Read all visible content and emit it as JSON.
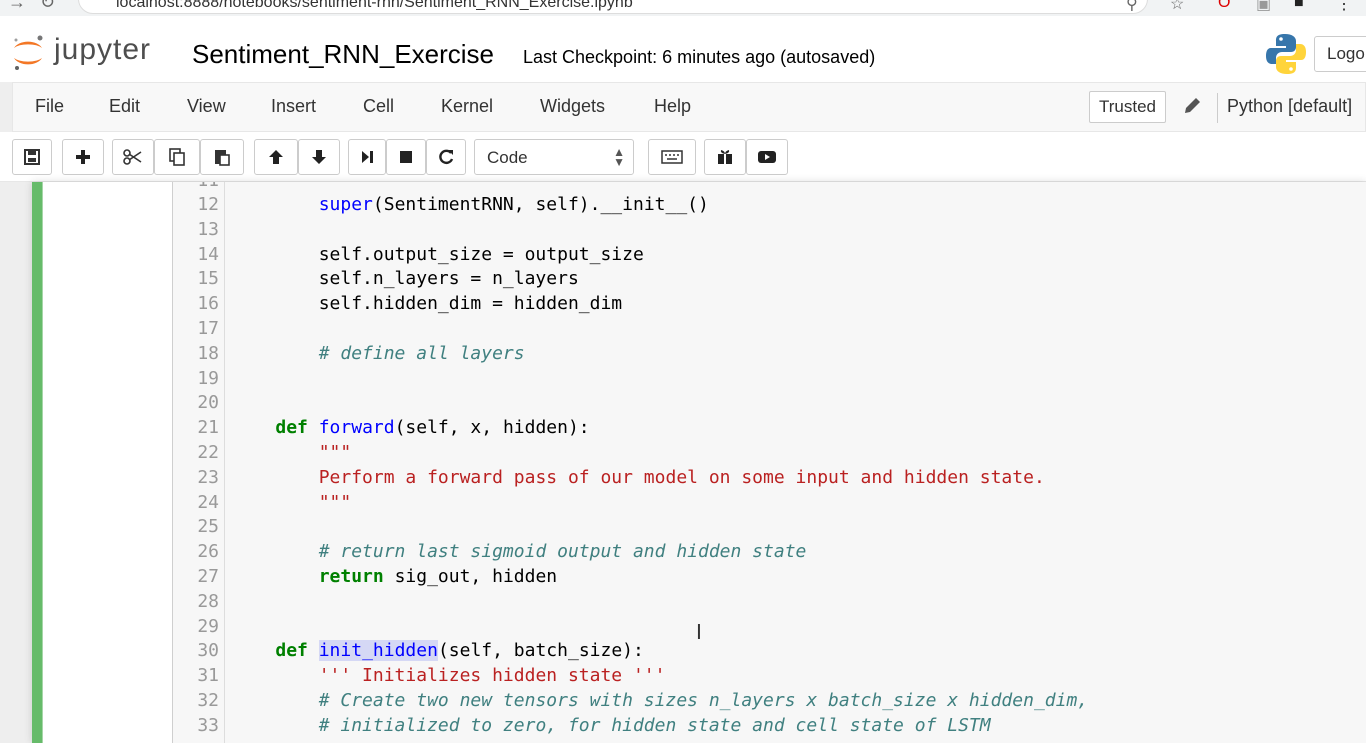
{
  "browser": {
    "url": "localhost:8888/notebooks/sentiment-rnn/Sentiment_RNN_Exercise.ipynb"
  },
  "header": {
    "logo_text": "jupyter",
    "notebook_title": "Sentiment_RNN_Exercise",
    "checkpoint": "Last Checkpoint: 6 minutes ago (autosaved)",
    "logout_label": "Logo"
  },
  "menubar": {
    "items": [
      "File",
      "Edit",
      "View",
      "Insert",
      "Cell",
      "Kernel",
      "Widgets",
      "Help"
    ],
    "trusted_label": "Trusted",
    "kernel_name": "Python [default]"
  },
  "toolbar": {
    "cell_type": "Code",
    "buttons": [
      "save-icon",
      "plus-icon",
      "cut-icon",
      "copy-icon",
      "paste-icon",
      "arrow-up-icon",
      "arrow-down-icon",
      "run-icon",
      "stop-icon",
      "restart-icon",
      "keyboard-icon",
      "gift-icon",
      "present-icon"
    ]
  },
  "code": {
    "partial_line_number": "11",
    "lines": [
      {
        "n": "12",
        "segments": [
          [
            "plain",
            "        "
          ],
          [
            "fn",
            "super"
          ],
          [
            "plain",
            "(SentimentRNN, self).__init__()"
          ]
        ]
      },
      {
        "n": "13",
        "segments": []
      },
      {
        "n": "14",
        "segments": [
          [
            "plain",
            "        self.output_size = output_size"
          ]
        ]
      },
      {
        "n": "15",
        "segments": [
          [
            "plain",
            "        self.n_layers = n_layers"
          ]
        ]
      },
      {
        "n": "16",
        "segments": [
          [
            "plain",
            "        self.hidden_dim = hidden_dim"
          ]
        ]
      },
      {
        "n": "17",
        "segments": []
      },
      {
        "n": "18",
        "segments": [
          [
            "plain",
            "        "
          ],
          [
            "cm",
            "# define all layers"
          ]
        ]
      },
      {
        "n": "19",
        "segments": []
      },
      {
        "n": "20",
        "segments": []
      },
      {
        "n": "21",
        "segments": [
          [
            "plain",
            "    "
          ],
          [
            "kw",
            "def"
          ],
          [
            "plain",
            " "
          ],
          [
            "fn",
            "forward"
          ],
          [
            "plain",
            "(self, x, hidden):"
          ]
        ]
      },
      {
        "n": "22",
        "segments": [
          [
            "plain",
            "        "
          ],
          [
            "str",
            "\"\"\""
          ]
        ]
      },
      {
        "n": "23",
        "segments": [
          [
            "plain",
            "        "
          ],
          [
            "str",
            "Perform a forward pass of our model on some input and hidden state."
          ]
        ]
      },
      {
        "n": "24",
        "segments": [
          [
            "plain",
            "        "
          ],
          [
            "str",
            "\"\"\""
          ]
        ]
      },
      {
        "n": "25",
        "segments": []
      },
      {
        "n": "26",
        "segments": [
          [
            "plain",
            "        "
          ],
          [
            "cm",
            "# return last sigmoid output and hidden state"
          ]
        ]
      },
      {
        "n": "27",
        "segments": [
          [
            "plain",
            "        "
          ],
          [
            "kw",
            "return"
          ],
          [
            "plain",
            " sig_out, hidden"
          ]
        ]
      },
      {
        "n": "28",
        "segments": []
      },
      {
        "n": "29",
        "segments": []
      },
      {
        "n": "30",
        "segments": [
          [
            "plain",
            "    "
          ],
          [
            "kw",
            "def"
          ],
          [
            "plain",
            " "
          ],
          [
            "fnhl",
            "init_hidden"
          ],
          [
            "plain",
            "(self, batch_size):"
          ]
        ]
      },
      {
        "n": "31",
        "segments": [
          [
            "plain",
            "        "
          ],
          [
            "str",
            "''' Initializes hidden state '''"
          ]
        ]
      },
      {
        "n": "32",
        "segments": [
          [
            "plain",
            "        "
          ],
          [
            "cm",
            "# Create two new tensors with sizes n_layers x batch_size x hidden_dim,"
          ]
        ]
      },
      {
        "n": "33",
        "segments": [
          [
            "plain",
            "        "
          ],
          [
            "cm",
            "# initialized to zero, for hidden state and cell state of LSTM"
          ]
        ]
      }
    ]
  }
}
